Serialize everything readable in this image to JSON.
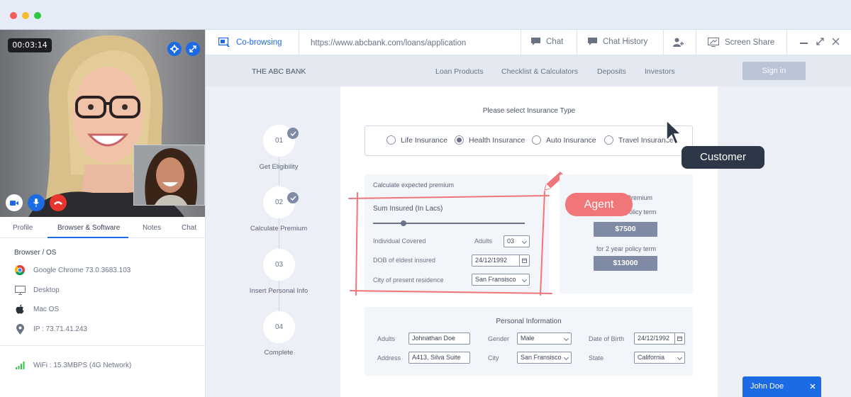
{
  "window": {
    "dots": [
      "#f25f57",
      "#f6bc30",
      "#2fc743"
    ]
  },
  "call": {
    "timer": "00:03:14",
    "controls": [
      "settings-icon",
      "expand-icon",
      "camera-icon",
      "microphone-icon",
      "hang-up-icon"
    ]
  },
  "left_tabs": [
    {
      "label": "Profile"
    },
    {
      "label": "Browser & Software",
      "active": true
    },
    {
      "label": "Notes"
    },
    {
      "label": "Chat"
    }
  ],
  "browser_os": {
    "heading": "Browser / OS",
    "items": [
      {
        "icon": "chrome-icon",
        "text": "Google Chrome 73.0.3683.103"
      },
      {
        "icon": "desktop-icon",
        "text": "Desktop"
      },
      {
        "icon": "apple-icon",
        "text": "Mac OS"
      },
      {
        "icon": "location-icon",
        "text": "IP : 73.71.41.243"
      }
    ],
    "network": {
      "icon": "signal-icon",
      "text": "WiFi : 15.3MBPS (4G Network)"
    }
  },
  "toolbar": {
    "cobrowse_label": "Co-browsing",
    "url": "https://www.abcbank.com/loans/application",
    "chat": "Chat",
    "chat_history": "Chat History",
    "screen_share": "Screen Share"
  },
  "site": {
    "brand": "THE ABC BANK",
    "nav": [
      "Loan Products",
      "Checklist & Calculators",
      "Deposits",
      "Investors"
    ],
    "signin": "Sign in"
  },
  "steps": [
    {
      "num": "01",
      "label": "Get Eligibility",
      "done": true
    },
    {
      "num": "02",
      "label": "Calculate Premium",
      "done": true
    },
    {
      "num": "03",
      "label": "Insert Personal Info",
      "done": false
    },
    {
      "num": "04",
      "label": "Complete",
      "done": false
    }
  ],
  "insurance": {
    "prompt": "Please select Insurance Type",
    "options": [
      "Life Insurance",
      "Health Insurance",
      "Auto Insurance",
      "Travel Insurance"
    ],
    "selected": "Health Insurance"
  },
  "premium_calc": {
    "title": "Calculate expected premium",
    "sum_insured_label": "Sum Insured (In Lacs)",
    "individual_label": "Individual Covered",
    "adults_label": "Adults",
    "adults_value": "03",
    "dob_label": "DOB of eldest insured",
    "dob_value": "24/12/1992",
    "city_label": "City of present residence",
    "city_value": "San Fransisco",
    "slider_fraction": 0.2
  },
  "premium_result": {
    "heading": "Premium",
    "term1": "policy term",
    "price1": "$7500",
    "term2": "for 2 year policy term",
    "price2": "$13000"
  },
  "personal": {
    "title": "Personal Information",
    "adults_label": "Adults",
    "adults_value": "Johnathan Doe",
    "gender_label": "Gender",
    "gender_value": "Male",
    "dob_label": "Date of Birth",
    "dob_value": "24/12/1992",
    "address_label": "Address",
    "address_value": "A413, Silva Suite",
    "city_label": "City",
    "city_value": "San Fransisco",
    "state_label": "State",
    "state_value": "California"
  },
  "annotations": {
    "agent": "Agent",
    "customer": "Customer"
  },
  "chat_pill": {
    "name": "John Doe"
  },
  "colors": {
    "accent": "#1c6ae4",
    "agent": "#f0767a",
    "hangup": "#e8352d",
    "signal": "#2fc743"
  }
}
